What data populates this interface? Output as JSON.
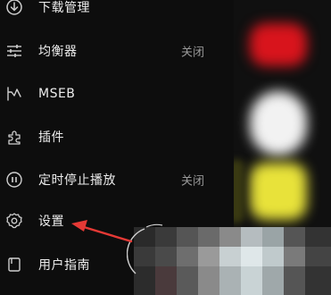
{
  "menu": {
    "items": [
      {
        "label": "下载管理",
        "value": "",
        "icon": "download-icon"
      },
      {
        "label": "均衡器",
        "value": "关闭",
        "icon": "equalizer-icon"
      },
      {
        "label": "MSEB",
        "value": "",
        "icon": "mseb-icon"
      },
      {
        "label": "插件",
        "value": "",
        "icon": "plugin-icon"
      },
      {
        "label": "定时停止播放",
        "value": "关闭",
        "icon": "timer-pause-icon"
      },
      {
        "label": "设置",
        "value": "",
        "icon": "gear-icon"
      },
      {
        "label": "用户指南",
        "value": "",
        "icon": "guide-book-icon"
      }
    ]
  },
  "colors": {
    "background": "#0b0b0b",
    "label": "#ececec",
    "value": "#9a9a9a",
    "annotation_arrow": "#e53935",
    "blur_red": "#d8141c",
    "blur_yellow": "#e8e23a",
    "blur_white": "#f2f2f2"
  }
}
